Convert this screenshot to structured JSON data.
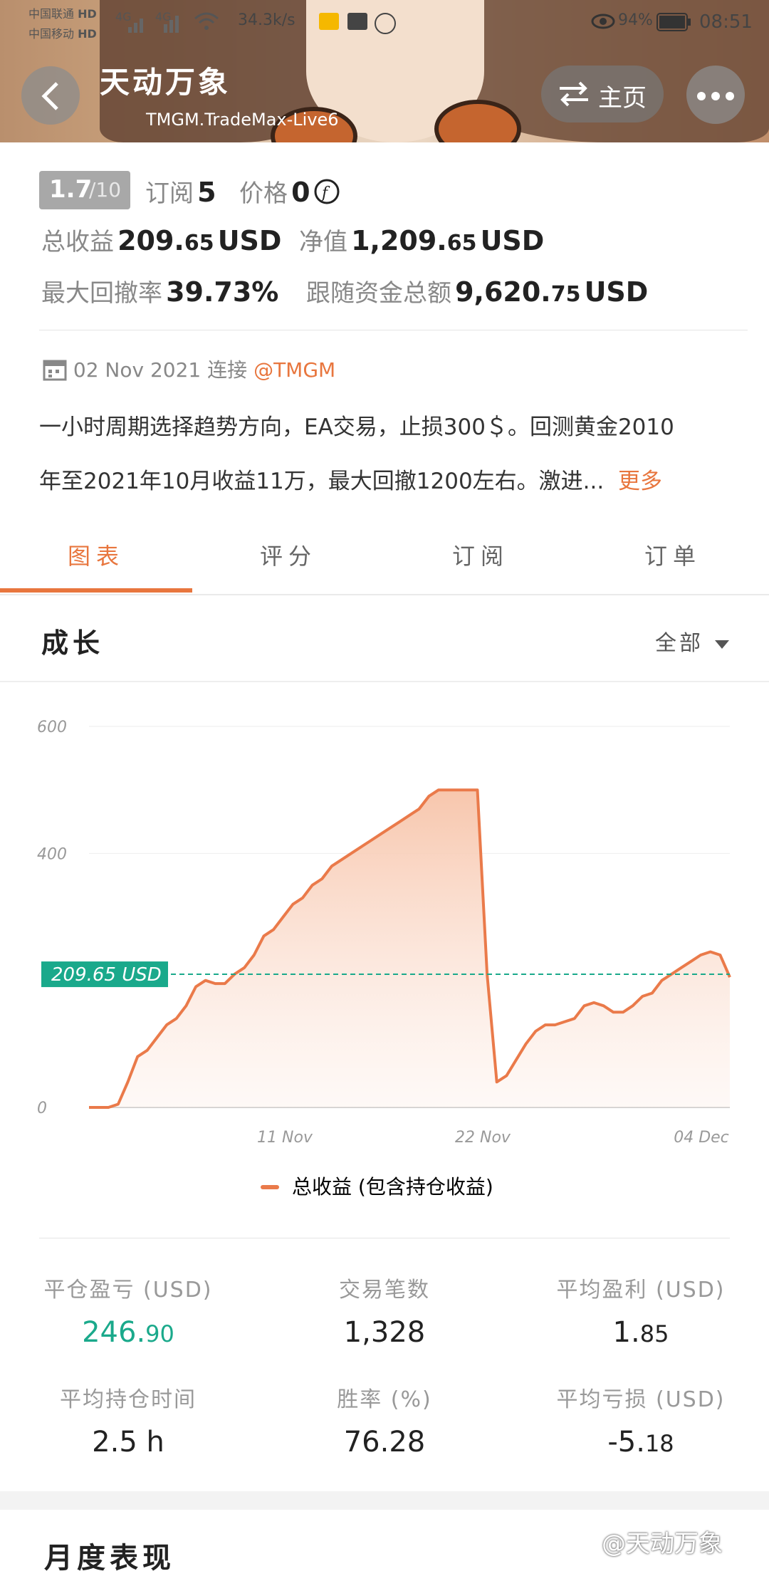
{
  "status_bar": {
    "carrier1": "中国联通",
    "carrier2": "中国移动",
    "hd": "HD",
    "net1": "4G",
    "net2": "4G",
    "speed": "34.3k/s",
    "battery": "94%",
    "time": "08:51"
  },
  "header": {
    "title": "天动万象",
    "subtitle": "TMGM.TradeMax-Live6",
    "home_label": "主页"
  },
  "stats": {
    "rating_main": "1.7",
    "rating_total": "/10",
    "subscribe_label": "订阅",
    "subscribe_value": "5",
    "price_label": "价格",
    "price_value": "0",
    "total_profit_label": "总收益",
    "total_profit_int": "209.",
    "total_profit_dec": "65",
    "total_profit_unit": "USD",
    "equity_label": "净值",
    "equity_int": "1,209.",
    "equity_dec": "65",
    "equity_unit": "USD",
    "drawdown_label": "最大回撤率",
    "drawdown_value": "39.73%",
    "follow_label": "跟随资金总额",
    "follow_int": "9,620.",
    "follow_dec": "75",
    "follow_unit": "USD"
  },
  "info": {
    "date": "02 Nov 2021",
    "connect_label": "连接",
    "broker": "@TMGM",
    "desc_line1": "一小时周期选择趋势方向，EA交易，止损300＄。回测黄金2010",
    "desc_line2": "年至2021年10月收益11万，最大回撤1200左右。激进...",
    "more": "更多"
  },
  "tabs": [
    "图表",
    "评分",
    "订阅",
    "订单"
  ],
  "growth": {
    "title": "成长",
    "filter": "全部"
  },
  "chart_data": {
    "type": "area",
    "y_ticks": [
      "600",
      "400",
      "0"
    ],
    "ylim": [
      0,
      600
    ],
    "x_ticks": [
      "11 Nov",
      "22 Nov",
      "04 Dec"
    ],
    "current_label": "209.65 USD",
    "current_value": 209.65,
    "legend": "总收益 (包含持仓收益)",
    "colors": {
      "line": "#ea7a4a",
      "fill": "#f7c3a8",
      "ref": "#1aa98b"
    },
    "series": [
      {
        "values": [
          0,
          0,
          0,
          5,
          40,
          80,
          90,
          110,
          130,
          140,
          160,
          190,
          200,
          195,
          195,
          210,
          220,
          240,
          270,
          280,
          300,
          320,
          330,
          350,
          360,
          380,
          390,
          400,
          410,
          420,
          430,
          440,
          450,
          460,
          470,
          490,
          500,
          500,
          500,
          500,
          500,
          210,
          40,
          50,
          75,
          100,
          120,
          130,
          130,
          135,
          140,
          160,
          165,
          160,
          150,
          150,
          160,
          175,
          180,
          200,
          210,
          220,
          230,
          240,
          245,
          240,
          205
        ]
      }
    ]
  },
  "metrics": [
    {
      "label": "平仓盈亏 (USD)",
      "int": "246.",
      "dec": "90",
      "color": "#1aa98b"
    },
    {
      "label": "交易笔数",
      "int": "1,328",
      "dec": "",
      "color": "#222222"
    },
    {
      "label": "平均盈利 (USD)",
      "int": "1.",
      "dec": "85",
      "color": "#222222"
    },
    {
      "label": "平均持仓时间",
      "int": "2.5 h",
      "dec": "",
      "color": "#222222"
    },
    {
      "label": "胜率 (%)",
      "int": "76.28",
      "dec": "",
      "color": "#222222"
    },
    {
      "label": "平均亏损 (USD)",
      "int": "-5.",
      "dec": "18",
      "color": "#222222"
    }
  ],
  "monthly_title": "月度表现",
  "watermark": "@天动万象"
}
